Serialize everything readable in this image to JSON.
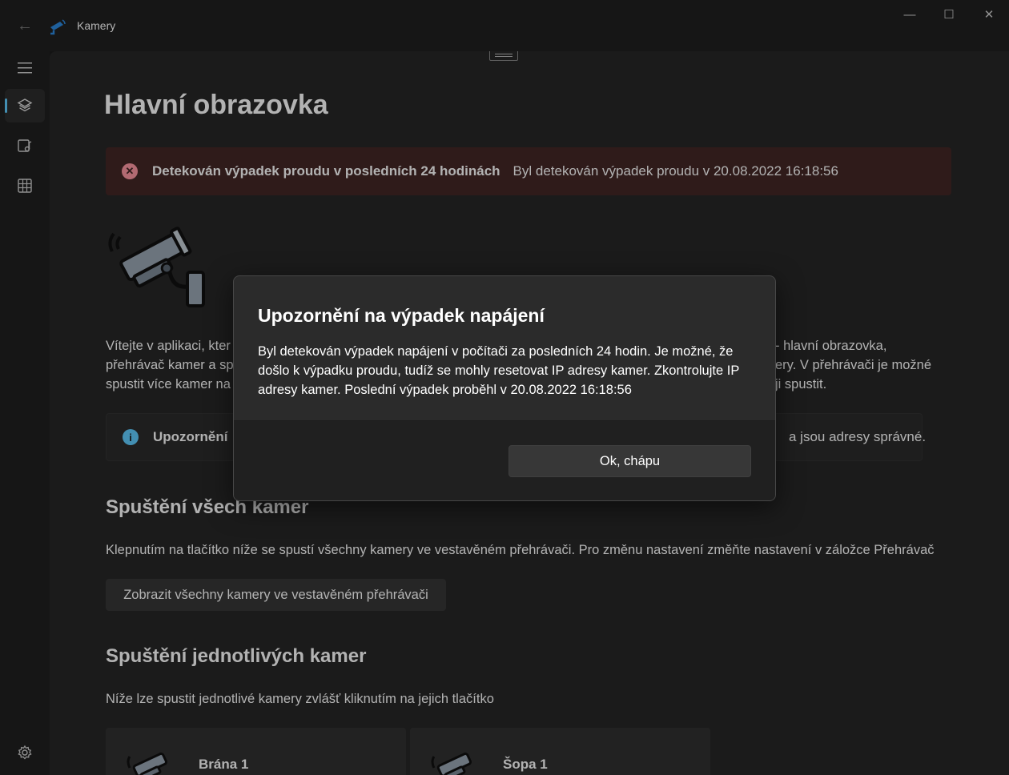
{
  "titlebar": {
    "app_title": "Kamery",
    "controls": {
      "minimize": "—",
      "maximize": "☐",
      "close": "✕"
    }
  },
  "nav": {
    "items": [
      "menu-icon",
      "home-icon",
      "player-icon",
      "grid-icon",
      "settings-icon"
    ]
  },
  "page": {
    "title": "Hlavní obrazovka",
    "alert": {
      "title": "Detekován výpadek proudu v posledních 24 hodinách",
      "message": "Byl detekován výpadek proudu v 20.08.2022 16:18:56",
      "severity_color": "#442726"
    },
    "intro_parts": {
      "a": "Vítejte v aplikaci, kter",
      "b": "- hlavní obrazovka,",
      "c": "přehrávač kamer a sp",
      "d": "ery. V přehrávači je možné",
      "e": "spustit více kamer na",
      "f": "ji spustit."
    },
    "notice": {
      "title": "Upozornění",
      "message_tail": "a jsou adresy správné."
    },
    "section_all": {
      "title": "Spuštění všech kamer",
      "description": "Klepnutím na tlačítko níže se spustí všechny kamery ve vestavěném přehrávači. Pro změnu nastavení změňte nastavení v záložce Přehrávač",
      "button": "Zobrazit všechny kamery ve vestavěném přehrávači"
    },
    "section_single": {
      "title": "Spuštění jednotlivých kamer",
      "description": "Níže lze spustit jednotlivé kamery zvlášť kliknutím na jejich tlačítko",
      "cameras": [
        "Brána 1",
        "Šopa 1"
      ]
    }
  },
  "dialog": {
    "title": "Upozornění na výpadek napájení",
    "body": "Byl detekován výpadek napájení v počítači za posledních 24 hodin. Je možné, že došlo k výpadku proudu, tudíž se mohly resetovat IP adresy kamer. Zkontrolujte IP adresy kamer. Poslední výpadek proběhl v 20.08.2022 16:18:56",
    "button": "Ok, chápu"
  },
  "colors": {
    "accent": "#60cdff",
    "background": "#272727",
    "error_bg": "#442726"
  }
}
